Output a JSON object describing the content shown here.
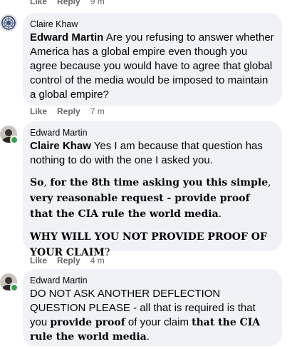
{
  "colors": {
    "bubble_bg": "#f0f2f5",
    "meta_text": "#65676b",
    "online": "#31a24c"
  },
  "top_actions": {
    "like": "Like",
    "reply": "Reply",
    "time": "9 m"
  },
  "comments": [
    {
      "author": "Claire Khaw",
      "avatar_icon": "mandala-avatar",
      "mention": "Edward Martin",
      "text": " Are you refusing to answer whether America has a global empire even though you agree because you would have to agree that global control of the media would be imposed to maintain a global empire?",
      "actions": {
        "like": "Like",
        "reply": "Reply",
        "time": "7 m"
      }
    },
    {
      "author": "Edward Martin",
      "avatar_icon": "person-avatar",
      "online": true,
      "mention": "Claire Khaw",
      "text": " Yes I am because that question has nothing to do with the one I asked you.",
      "para2": {
        "part1": "So",
        "part2": ", ",
        "part3": "for the 8th time asking you this simple",
        "part4": ", ",
        "part5": "very reasonable request - provide proof that the CIA rule the world media",
        "part6": "."
      },
      "para3": {
        "part1": "WHY WILL YOU NOT PROVIDE PROOF OF YOUR CLAIM",
        "part2": "?"
      },
      "actions": {
        "like": "Like",
        "reply": "Reply",
        "time": "4 m"
      }
    },
    {
      "author": "Edward Martin",
      "avatar_icon": "person-avatar",
      "online": true,
      "text_start": "DO NOT ASK ANOTHER DEFLECTION QUESTION PLEASE - all that is required is that you ",
      "bold1": "provide proof",
      "mid": " of your claim ",
      "bold2": "that the CIA rule the world media",
      "end": "."
    }
  ]
}
